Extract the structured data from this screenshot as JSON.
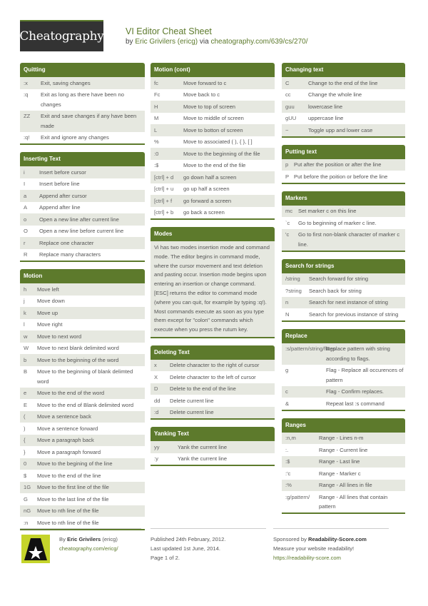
{
  "header": {
    "logo": "Cheatography",
    "title": "VI Editor Cheat Sheet",
    "by": "by",
    "author": "Eric Grivilers (ericg)",
    "via": "via",
    "url": "cheatography.com/639/cs/270/"
  },
  "sections": {
    "quitting": {
      "title": "Quitting",
      "rows": [
        {
          "k": ":x",
          "v": "Exit, saving changes"
        },
        {
          "k": ":q",
          "v": "Exit as long as there have been no changes"
        },
        {
          "k": "ZZ",
          "v": "Exit and save changes if any have been made"
        },
        {
          "k": ":q!",
          "v": "Exit and ignore any changes"
        }
      ]
    },
    "inserting": {
      "title": "Inserting Text",
      "rows": [
        {
          "k": "i",
          "v": "Insert before cursor"
        },
        {
          "k": "I",
          "v": "Insert before line"
        },
        {
          "k": "a",
          "v": "Append after cursor"
        },
        {
          "k": "A",
          "v": "Append after line"
        },
        {
          "k": "o",
          "v": "Open a new line after current line"
        },
        {
          "k": "O",
          "v": "Open a new line before current line"
        },
        {
          "k": "r",
          "v": "Replace one character"
        },
        {
          "k": "R",
          "v": "Replace many characters"
        }
      ]
    },
    "motion": {
      "title": "Motion",
      "rows": [
        {
          "k": "h",
          "v": "Move left"
        },
        {
          "k": "j",
          "v": "Move down"
        },
        {
          "k": "k",
          "v": "Move up"
        },
        {
          "k": "l",
          "v": "Move right"
        },
        {
          "k": "w",
          "v": "Move to next word"
        },
        {
          "k": "W",
          "v": "Move to next blank delimited word"
        },
        {
          "k": "b",
          "v": "Move to the beginning of the word"
        },
        {
          "k": "B",
          "v": "Move to the beginning of blank delimted word"
        },
        {
          "k": "e",
          "v": "Move to the end of the word"
        },
        {
          "k": "E",
          "v": "Move to the end of Blank delimited word"
        },
        {
          "k": "(",
          "v": "Move a sentence back"
        },
        {
          "k": ")",
          "v": "Move a sentence forward"
        },
        {
          "k": "{",
          "v": "Move a paragraph back"
        },
        {
          "k": "}",
          "v": "Move a paragraph forward"
        },
        {
          "k": "0",
          "v": "Move to the begining of the line"
        },
        {
          "k": "$",
          "v": "Move to the end of the line"
        },
        {
          "k": "1G",
          "v": "Move to the first line of the file"
        },
        {
          "k": "G",
          "v": "Move to the last line of the file"
        },
        {
          "k": "nG",
          "v": "Move to nth line of the file"
        },
        {
          "k": ":n",
          "v": "Move to nth line of the file"
        }
      ]
    },
    "motion_cont": {
      "title": "Motion (cont)",
      "rows": [
        {
          "k": "fc",
          "v": "Move forward to c"
        },
        {
          "k": "Fc",
          "v": "Move back to c"
        },
        {
          "k": "H",
          "v": "Move to top of screen"
        },
        {
          "k": "M",
          "v": "Move to middle of screen"
        },
        {
          "k": "L",
          "v": "Move to botton of screen"
        },
        {
          "k": "%",
          "v": "Move to associated ( ), { }, [ ]"
        },
        {
          "k": ":0",
          "v": "Move to the beginning of the file"
        },
        {
          "k": ":$",
          "v": "Move to the end of the file"
        },
        {
          "k": "[ctrl] + d",
          "v": "go down half a screen"
        },
        {
          "k": "[ctrl] + u",
          "v": "go up half a screen"
        },
        {
          "k": "[ctrl] + f",
          "v": "go forward a screen"
        },
        {
          "k": "[ctrl] + b",
          "v": "go back a screen"
        }
      ]
    },
    "modes": {
      "title": "Modes",
      "text": "Vi has two modes insertion mode and command mode. The editor begins in command mode, where the cursor movement and text deletion and pasting occur. Insertion mode begins upon entering an insertion or change command. [ESC] returns the editor to command mode (where you can quit, for example by typing :q!). Most commands execute as soon as you type them except for \"colon\" commands which execute when you press the rutum key."
    },
    "deleting": {
      "title": "Deleting Text",
      "rows": [
        {
          "k": "x",
          "v": "Delete character to the right of cursor"
        },
        {
          "k": "X",
          "v": "Delete character to the left of cursor"
        },
        {
          "k": "D",
          "v": "Delete to the end of the line"
        },
        {
          "k": "dd",
          "v": "Delete current line"
        },
        {
          "k": ":d",
          "v": "Delete current line"
        }
      ]
    },
    "yanking": {
      "title": "Yanking Text",
      "rows": [
        {
          "k": "yy",
          "v": "Yank the current line"
        },
        {
          "k": ":y",
          "v": "Yank the current line"
        }
      ]
    },
    "changing": {
      "title": "Changing text",
      "rows": [
        {
          "k": "C",
          "v": "Change to the end of the line"
        },
        {
          "k": "cc",
          "v": "Change the whole line"
        },
        {
          "k": "guu",
          "v": "lowercase line"
        },
        {
          "k": "gUU",
          "v": "uppercase line"
        },
        {
          "k": "~",
          "v": "Toggle upp and lower case"
        }
      ]
    },
    "putting": {
      "title": "Putting text",
      "rows": [
        {
          "k": "p",
          "v": "Put after the position or after the line"
        },
        {
          "k": "P",
          "v": "Put before the poition or before the line"
        }
      ]
    },
    "markers": {
      "title": "Markers",
      "rows": [
        {
          "k": "mc",
          "v": "Set marker c on this line"
        },
        {
          "k": "`c",
          "v": "Go to beginning of marker c line."
        },
        {
          "k": "'c",
          "v": "Go to first non-blank character of marker c line."
        }
      ]
    },
    "search": {
      "title": "Search for strings",
      "rows": [
        {
          "k": "/string",
          "v": "Search forward for string"
        },
        {
          "k": "?string",
          "v": "Search back for string"
        },
        {
          "k": "n",
          "v": "Search for next instance of string"
        },
        {
          "k": "N",
          "v": "Search for previous instance of string"
        }
      ]
    },
    "replace": {
      "title": "Replace",
      "rows": [
        {
          "k": ":s/pattern/string/flags",
          "v": "Replace pattern with string according to flags."
        },
        {
          "k": "g",
          "v": "Flag - Replace all occurences of pattern"
        },
        {
          "k": "c",
          "v": "Flag - Confirm replaces."
        },
        {
          "k": "&",
          "v": "Repeat last :s command"
        }
      ]
    },
    "ranges": {
      "title": "Ranges",
      "rows": [
        {
          "k": ":n,m",
          "v": "Range - Lines n-m"
        },
        {
          "k": ":.",
          "v": "Range - Current line"
        },
        {
          "k": ":$",
          "v": "Range - Last line"
        },
        {
          "k": ":'c",
          "v": "Range - Marker c"
        },
        {
          "k": ":%",
          "v": "Range - All lines in file"
        },
        {
          "k": ":g/pattern/",
          "v": "Range - All lines that contain pattern"
        }
      ]
    }
  },
  "footer": {
    "by": "By",
    "author": "Eric Grivilers",
    "handle": "(ericg)",
    "profile_url": "cheatography.com/ericg/",
    "published": "Published 24th February, 2012.",
    "updated": "Last updated 1st June, 2014.",
    "page": "Page 1 of 2.",
    "sponsored_by": "Sponsored by",
    "sponsor": "Readability-Score.com",
    "sponsor_tagline": "Measure your website readability!",
    "sponsor_url": "https://readability-score.com"
  }
}
